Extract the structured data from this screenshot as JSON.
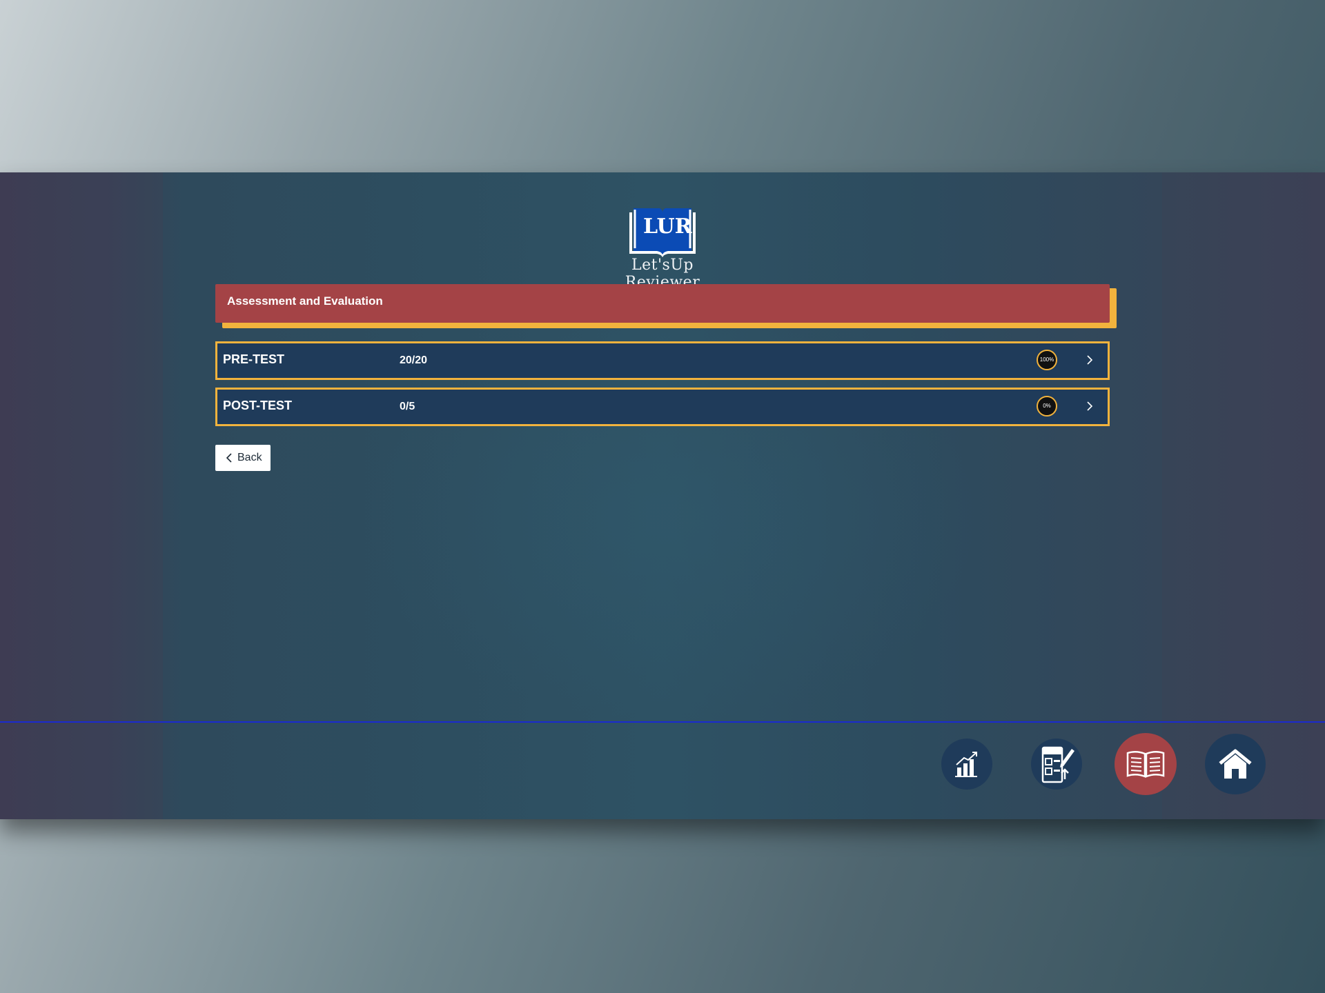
{
  "app": {
    "logo_letters": "LUR",
    "logo_name": "Let'sUp Reviewer"
  },
  "subject": {
    "title": "Assessment and Evaluation"
  },
  "tests": [
    {
      "name": "PRE-TEST",
      "score": "20/20",
      "progress_label": "100%",
      "progress_value": 1.0
    },
    {
      "name": "POST-TEST",
      "score": "0/5",
      "progress_label": "0%",
      "progress_value": 0.0
    }
  ],
  "actions": {
    "back_label": "Back"
  },
  "nav": {
    "items": [
      {
        "name": "statistics",
        "icon": "bar-chart-growth-icon",
        "active": false
      },
      {
        "name": "exams",
        "icon": "test-sheet-pencil-icon",
        "active": false
      },
      {
        "name": "reviewer",
        "icon": "open-book-icon",
        "active": true
      },
      {
        "name": "home",
        "icon": "house-icon",
        "active": false
      }
    ]
  },
  "colors": {
    "accent_gold": "#f2b33d",
    "header_red": "#a44346",
    "row_navy": "#1f3b5a",
    "logo_blue": "#0b4bb5",
    "divider_blue": "#1a2ad0"
  }
}
